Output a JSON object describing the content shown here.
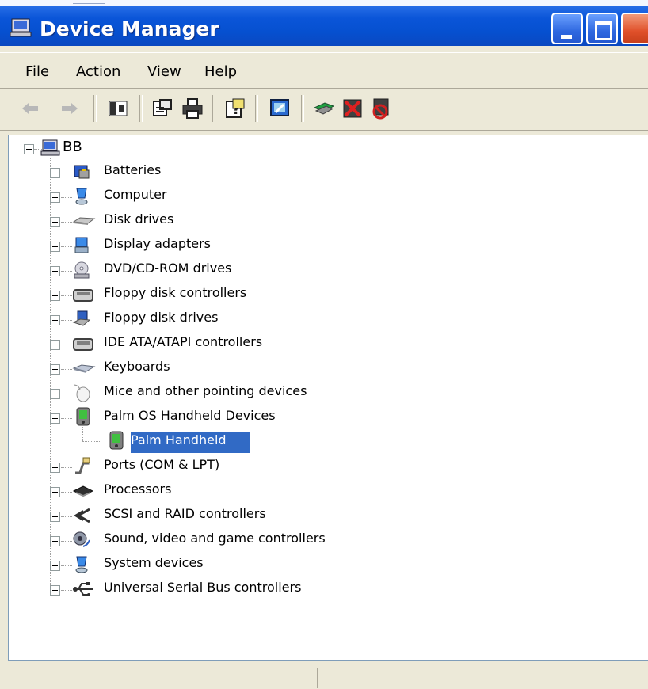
{
  "window": {
    "title": "Device Manager",
    "title_icon": "computer-icon",
    "controls": [
      "minimize",
      "maximize",
      "close"
    ]
  },
  "menu": [
    {
      "label": "File"
    },
    {
      "label": "Action"
    },
    {
      "label": "View"
    },
    {
      "label": "Help"
    }
  ],
  "toolbar": [
    {
      "name": "back-icon"
    },
    {
      "name": "forward-icon"
    },
    {
      "name": "show-hide-console-tree-icon"
    },
    {
      "name": "properties-icon"
    },
    {
      "name": "print-icon"
    },
    {
      "name": "help-icon"
    },
    {
      "name": "scan-hardware-changes-icon"
    },
    {
      "name": "update-driver-icon"
    },
    {
      "name": "uninstall-icon"
    },
    {
      "name": "disable-icon"
    }
  ],
  "tree": {
    "root": {
      "label": "BB",
      "expanded": true
    },
    "items": [
      {
        "label": "Batteries",
        "icon": "battery-icon"
      },
      {
        "label": "Computer",
        "icon": "computer-icon"
      },
      {
        "label": "Disk drives",
        "icon": "disk-drive-icon"
      },
      {
        "label": "Display adapters",
        "icon": "display-adapter-icon"
      },
      {
        "label": "DVD/CD-ROM drives",
        "icon": "cdrom-icon"
      },
      {
        "label": "Floppy disk controllers",
        "icon": "floppy-controller-icon"
      },
      {
        "label": "Floppy disk drives",
        "icon": "floppy-drive-icon"
      },
      {
        "label": "IDE ATA/ATAPI controllers",
        "icon": "ide-controller-icon"
      },
      {
        "label": "Keyboards",
        "icon": "keyboard-icon"
      },
      {
        "label": "Mice and other pointing devices",
        "icon": "mouse-icon"
      },
      {
        "label": "Palm OS Handheld Devices",
        "icon": "palm-handheld-icon",
        "expanded": true,
        "children": [
          {
            "label": "Palm Handheld",
            "icon": "palm-handheld-icon",
            "selected": true
          }
        ]
      },
      {
        "label": "Ports (COM & LPT)",
        "icon": "port-icon"
      },
      {
        "label": "Processors",
        "icon": "processor-icon"
      },
      {
        "label": "SCSI and RAID controllers",
        "icon": "scsi-icon"
      },
      {
        "label": "Sound, video and game controllers",
        "icon": "sound-icon"
      },
      {
        "label": "System devices",
        "icon": "system-devices-icon"
      },
      {
        "label": "Universal Serial Bus controllers",
        "icon": "usb-icon"
      }
    ]
  },
  "colors": {
    "title_bar": "#0a55d8",
    "selection": "#316ac5",
    "window_bg": "#ece9d8",
    "close_button": "#e0502a"
  }
}
